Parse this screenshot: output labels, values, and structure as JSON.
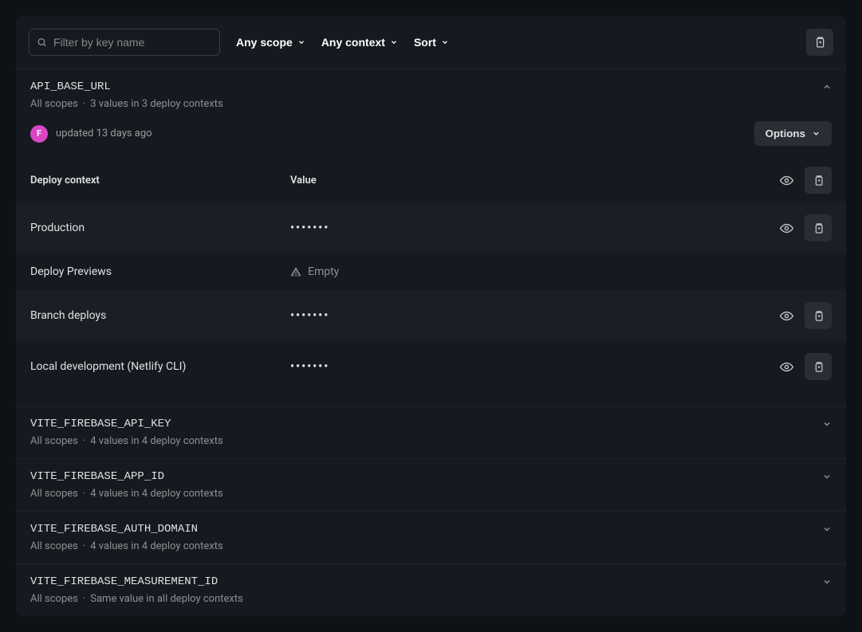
{
  "toolbar": {
    "search_placeholder": "Filter by key name",
    "scope_label": "Any scope",
    "context_label": "Any context",
    "sort_label": "Sort"
  },
  "expanded": {
    "name": "API_BASE_URL",
    "scope": "All scopes",
    "values_summary": "3 values in 3 deploy contexts",
    "avatar_letter": "F",
    "updated_text": "updated 13 days ago",
    "options_label": "Options",
    "columns": {
      "context": "Deploy context",
      "value": "Value"
    },
    "rows": [
      {
        "context": "Production",
        "value": "•••••••",
        "empty": false,
        "has_actions": true
      },
      {
        "context": "Deploy Previews",
        "value": "Empty",
        "empty": true,
        "has_actions": false
      },
      {
        "context": "Branch deploys",
        "value": "•••••••",
        "empty": false,
        "has_actions": true
      },
      {
        "context": "Local development (Netlify CLI)",
        "value": "•••••••",
        "empty": false,
        "has_actions": true
      }
    ]
  },
  "collapsed": [
    {
      "name": "VITE_FIREBASE_API_KEY",
      "scope": "All scopes",
      "summary": "4 values in 4 deploy contexts"
    },
    {
      "name": "VITE_FIREBASE_APP_ID",
      "scope": "All scopes",
      "summary": "4 values in 4 deploy contexts"
    },
    {
      "name": "VITE_FIREBASE_AUTH_DOMAIN",
      "scope": "All scopes",
      "summary": "4 values in 4 deploy contexts"
    },
    {
      "name": "VITE_FIREBASE_MEASUREMENT_ID",
      "scope": "All scopes",
      "summary": "Same value in all deploy contexts"
    }
  ]
}
